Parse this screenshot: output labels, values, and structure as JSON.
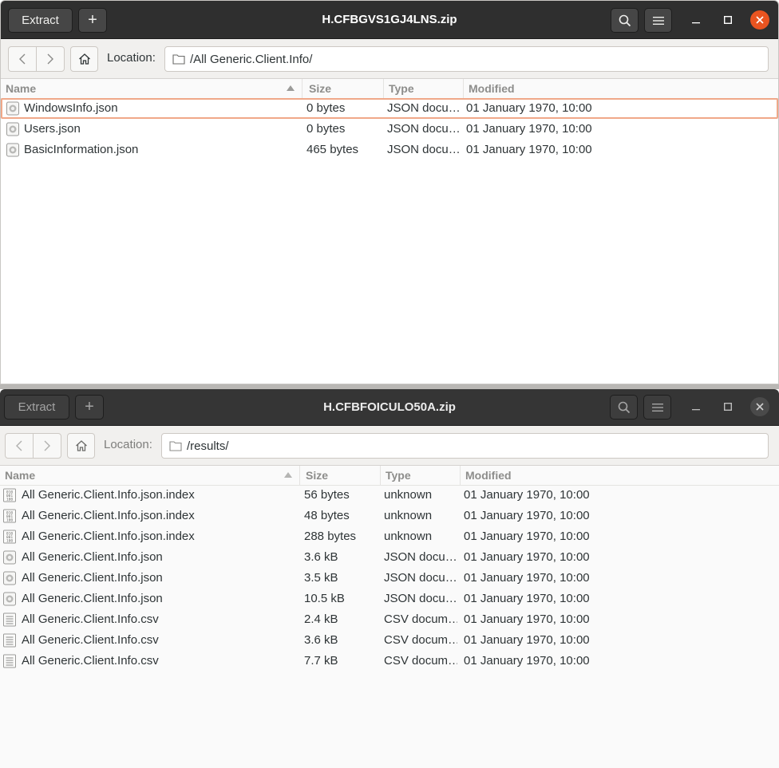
{
  "window1": {
    "extract_label": "Extract",
    "title": "H.CFBGVS1GJ4LNS.zip",
    "location_label": "Location:",
    "location_value": "/All Generic.Client.Info/",
    "columns": {
      "name": "Name",
      "size": "Size",
      "type": "Type",
      "modified": "Modified"
    },
    "files": [
      {
        "name": "WindowsInfo.json",
        "size": "0 bytes",
        "type": "JSON docu…",
        "modified": "01 January 1970, 10:00",
        "icon": "json-file-icon"
      },
      {
        "name": "Users.json",
        "size": "0 bytes",
        "type": "JSON docu…",
        "modified": "01 January 1970, 10:00",
        "icon": "json-file-icon"
      },
      {
        "name": "BasicInformation.json",
        "size": "465 bytes",
        "type": "JSON docu…",
        "modified": "01 January 1970, 10:00",
        "icon": "json-file-icon"
      }
    ]
  },
  "window2": {
    "extract_label": "Extract",
    "title": "H.CFBFOICULO50A.zip",
    "location_label": "Location:",
    "location_value": "/results/",
    "columns": {
      "name": "Name",
      "size": "Size",
      "type": "Type",
      "modified": "Modified"
    },
    "files": [
      {
        "name": "All Generic.Client.Info.json.index",
        "size": "56 bytes",
        "type": "unknown",
        "modified": "01 January 1970, 10:00",
        "icon": "binary-file-icon"
      },
      {
        "name": "All Generic.Client.Info.json.index",
        "size": "48 bytes",
        "type": "unknown",
        "modified": "01 January 1970, 10:00",
        "icon": "binary-file-icon"
      },
      {
        "name": "All Generic.Client.Info.json.index",
        "size": "288 bytes",
        "type": "unknown",
        "modified": "01 January 1970, 10:00",
        "icon": "binary-file-icon"
      },
      {
        "name": "All Generic.Client.Info.json",
        "size": "3.6 kB",
        "type": "JSON docu…",
        "modified": "01 January 1970, 10:00",
        "icon": "json-file-icon"
      },
      {
        "name": "All Generic.Client.Info.json",
        "size": "3.5 kB",
        "type": "JSON docu…",
        "modified": "01 January 1970, 10:00",
        "icon": "json-file-icon"
      },
      {
        "name": "All Generic.Client.Info.json",
        "size": "10.5 kB",
        "type": "JSON docu…",
        "modified": "01 January 1970, 10:00",
        "icon": "json-file-icon"
      },
      {
        "name": "All Generic.Client.Info.csv",
        "size": "2.4 kB",
        "type": "CSV docum…",
        "modified": "01 January 1970, 10:00",
        "icon": "csv-file-icon"
      },
      {
        "name": "All Generic.Client.Info.csv",
        "size": "3.6 kB",
        "type": "CSV docum…",
        "modified": "01 January 1970, 10:00",
        "icon": "csv-file-icon"
      },
      {
        "name": "All Generic.Client.Info.csv",
        "size": "7.7 kB",
        "type": "CSV docum…",
        "modified": "01 January 1970, 10:00",
        "icon": "csv-file-icon"
      }
    ]
  },
  "colors": {
    "accent": "#e95420",
    "selection_border": "#f0a889",
    "header_dark": "#2f2f2f"
  }
}
